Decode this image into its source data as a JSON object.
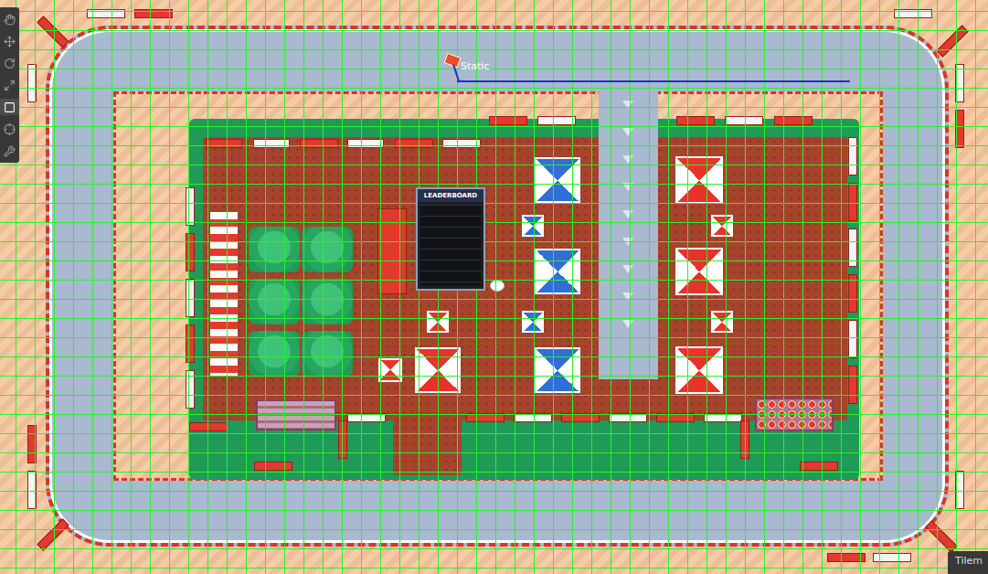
{
  "toolbar": {
    "tools": [
      {
        "selected": false
      },
      {
        "selected": false
      },
      {
        "selected": false
      },
      {
        "selected": false
      },
      {
        "selected": true
      },
      {
        "selected": false
      },
      {
        "selected": false
      }
    ]
  },
  "scene": {
    "gizmo_label": "Static",
    "leaderboard": {
      "title": "LEADERBOARD"
    },
    "tents": [
      {
        "color": "#2f6fd6"
      },
      {
        "color": "#2f6fd6"
      },
      {
        "color": "#2f6fd6"
      },
      {
        "color": "#2f6fd6"
      },
      {
        "color": "#2f6fd6"
      },
      {
        "color": "#e8322a"
      },
      {
        "color": "#e8322a"
      },
      {
        "color": "#e8322a"
      },
      {
        "color": "#e8322a"
      },
      {
        "color": "#e8322a"
      },
      {
        "color": "#e8322a"
      },
      {
        "color": "#e8322a"
      },
      {
        "color": "#e8322a"
      }
    ]
  },
  "panel_tab": {
    "label": "Tilem"
  }
}
